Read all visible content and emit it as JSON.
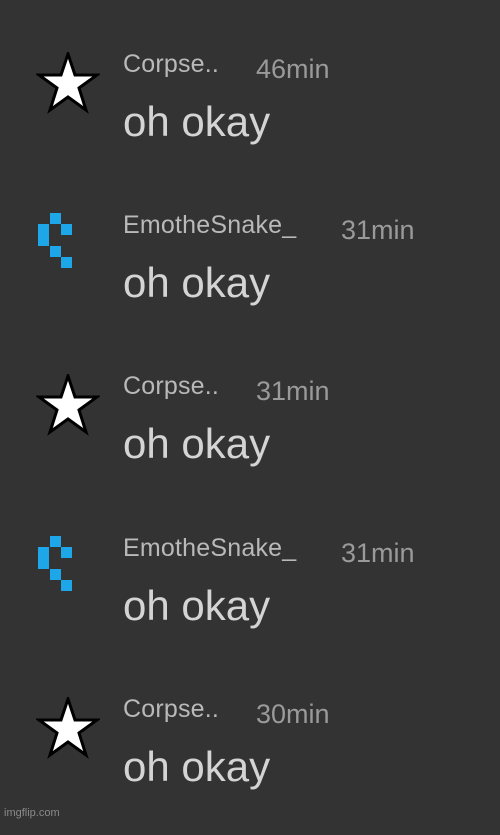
{
  "messages": [
    {
      "user": "Corpse..",
      "time": "46min",
      "text": "oh okay",
      "avatar_icon": "star-icon"
    },
    {
      "user": "EmotheSnake_",
      "time": "31min",
      "text": "oh okay",
      "avatar_icon": "pixel-snake-icon"
    },
    {
      "user": "Corpse..",
      "time": "31min",
      "text": "oh okay",
      "avatar_icon": "star-icon"
    },
    {
      "user": "EmotheSnake_",
      "time": "31min",
      "text": "oh okay",
      "avatar_icon": "pixel-snake-icon"
    },
    {
      "user": "Corpse..",
      "time": "30min",
      "text": "oh okay",
      "avatar_icon": "star-icon"
    }
  ],
  "colors": {
    "background": "#333333",
    "star_fill": "#ffffff",
    "snake_blue": "#1ea7e8"
  },
  "watermark": "imgflip.com"
}
